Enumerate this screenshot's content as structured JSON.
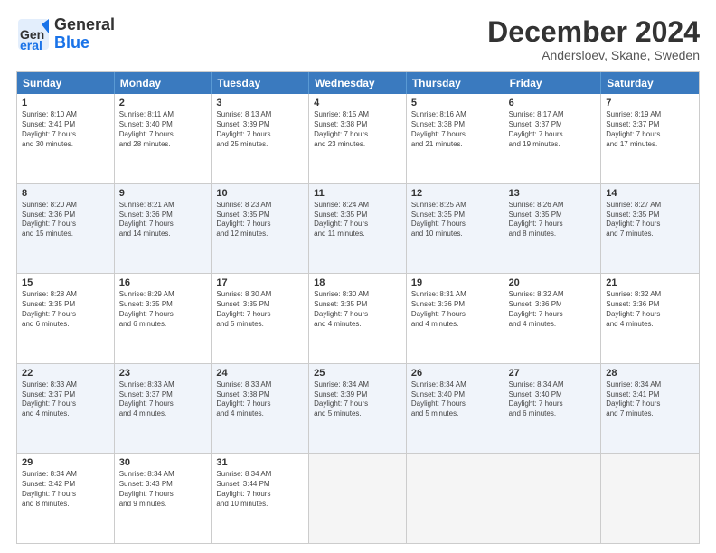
{
  "header": {
    "logo_general": "General",
    "logo_blue": "Blue",
    "month_title": "December 2024",
    "location": "Andersloev, Skane, Sweden"
  },
  "days_of_week": [
    "Sunday",
    "Monday",
    "Tuesday",
    "Wednesday",
    "Thursday",
    "Friday",
    "Saturday"
  ],
  "weeks": [
    [
      {
        "day": "1",
        "lines": [
          "Sunrise: 8:10 AM",
          "Sunset: 3:41 PM",
          "Daylight: 7 hours",
          "and 30 minutes."
        ]
      },
      {
        "day": "2",
        "lines": [
          "Sunrise: 8:11 AM",
          "Sunset: 3:40 PM",
          "Daylight: 7 hours",
          "and 28 minutes."
        ]
      },
      {
        "day": "3",
        "lines": [
          "Sunrise: 8:13 AM",
          "Sunset: 3:39 PM",
          "Daylight: 7 hours",
          "and 25 minutes."
        ]
      },
      {
        "day": "4",
        "lines": [
          "Sunrise: 8:15 AM",
          "Sunset: 3:38 PM",
          "Daylight: 7 hours",
          "and 23 minutes."
        ]
      },
      {
        "day": "5",
        "lines": [
          "Sunrise: 8:16 AM",
          "Sunset: 3:38 PM",
          "Daylight: 7 hours",
          "and 21 minutes."
        ]
      },
      {
        "day": "6",
        "lines": [
          "Sunrise: 8:17 AM",
          "Sunset: 3:37 PM",
          "Daylight: 7 hours",
          "and 19 minutes."
        ]
      },
      {
        "day": "7",
        "lines": [
          "Sunrise: 8:19 AM",
          "Sunset: 3:37 PM",
          "Daylight: 7 hours",
          "and 17 minutes."
        ]
      }
    ],
    [
      {
        "day": "8",
        "lines": [
          "Sunrise: 8:20 AM",
          "Sunset: 3:36 PM",
          "Daylight: 7 hours",
          "and 15 minutes."
        ]
      },
      {
        "day": "9",
        "lines": [
          "Sunrise: 8:21 AM",
          "Sunset: 3:36 PM",
          "Daylight: 7 hours",
          "and 14 minutes."
        ]
      },
      {
        "day": "10",
        "lines": [
          "Sunrise: 8:23 AM",
          "Sunset: 3:35 PM",
          "Daylight: 7 hours",
          "and 12 minutes."
        ]
      },
      {
        "day": "11",
        "lines": [
          "Sunrise: 8:24 AM",
          "Sunset: 3:35 PM",
          "Daylight: 7 hours",
          "and 11 minutes."
        ]
      },
      {
        "day": "12",
        "lines": [
          "Sunrise: 8:25 AM",
          "Sunset: 3:35 PM",
          "Daylight: 7 hours",
          "and 10 minutes."
        ]
      },
      {
        "day": "13",
        "lines": [
          "Sunrise: 8:26 AM",
          "Sunset: 3:35 PM",
          "Daylight: 7 hours",
          "and 8 minutes."
        ]
      },
      {
        "day": "14",
        "lines": [
          "Sunrise: 8:27 AM",
          "Sunset: 3:35 PM",
          "Daylight: 7 hours",
          "and 7 minutes."
        ]
      }
    ],
    [
      {
        "day": "15",
        "lines": [
          "Sunrise: 8:28 AM",
          "Sunset: 3:35 PM",
          "Daylight: 7 hours",
          "and 6 minutes."
        ]
      },
      {
        "day": "16",
        "lines": [
          "Sunrise: 8:29 AM",
          "Sunset: 3:35 PM",
          "Daylight: 7 hours",
          "and 6 minutes."
        ]
      },
      {
        "day": "17",
        "lines": [
          "Sunrise: 8:30 AM",
          "Sunset: 3:35 PM",
          "Daylight: 7 hours",
          "and 5 minutes."
        ]
      },
      {
        "day": "18",
        "lines": [
          "Sunrise: 8:30 AM",
          "Sunset: 3:35 PM",
          "Daylight: 7 hours",
          "and 4 minutes."
        ]
      },
      {
        "day": "19",
        "lines": [
          "Sunrise: 8:31 AM",
          "Sunset: 3:36 PM",
          "Daylight: 7 hours",
          "and 4 minutes."
        ]
      },
      {
        "day": "20",
        "lines": [
          "Sunrise: 8:32 AM",
          "Sunset: 3:36 PM",
          "Daylight: 7 hours",
          "and 4 minutes."
        ]
      },
      {
        "day": "21",
        "lines": [
          "Sunrise: 8:32 AM",
          "Sunset: 3:36 PM",
          "Daylight: 7 hours",
          "and 4 minutes."
        ]
      }
    ],
    [
      {
        "day": "22",
        "lines": [
          "Sunrise: 8:33 AM",
          "Sunset: 3:37 PM",
          "Daylight: 7 hours",
          "and 4 minutes."
        ]
      },
      {
        "day": "23",
        "lines": [
          "Sunrise: 8:33 AM",
          "Sunset: 3:37 PM",
          "Daylight: 7 hours",
          "and 4 minutes."
        ]
      },
      {
        "day": "24",
        "lines": [
          "Sunrise: 8:33 AM",
          "Sunset: 3:38 PM",
          "Daylight: 7 hours",
          "and 4 minutes."
        ]
      },
      {
        "day": "25",
        "lines": [
          "Sunrise: 8:34 AM",
          "Sunset: 3:39 PM",
          "Daylight: 7 hours",
          "and 5 minutes."
        ]
      },
      {
        "day": "26",
        "lines": [
          "Sunrise: 8:34 AM",
          "Sunset: 3:40 PM",
          "Daylight: 7 hours",
          "and 5 minutes."
        ]
      },
      {
        "day": "27",
        "lines": [
          "Sunrise: 8:34 AM",
          "Sunset: 3:40 PM",
          "Daylight: 7 hours",
          "and 6 minutes."
        ]
      },
      {
        "day": "28",
        "lines": [
          "Sunrise: 8:34 AM",
          "Sunset: 3:41 PM",
          "Daylight: 7 hours",
          "and 7 minutes."
        ]
      }
    ],
    [
      {
        "day": "29",
        "lines": [
          "Sunrise: 8:34 AM",
          "Sunset: 3:42 PM",
          "Daylight: 7 hours",
          "and 8 minutes."
        ]
      },
      {
        "day": "30",
        "lines": [
          "Sunrise: 8:34 AM",
          "Sunset: 3:43 PM",
          "Daylight: 7 hours",
          "and 9 minutes."
        ]
      },
      {
        "day": "31",
        "lines": [
          "Sunrise: 8:34 AM",
          "Sunset: 3:44 PM",
          "Daylight: 7 hours",
          "and 10 minutes."
        ]
      },
      {
        "day": "",
        "lines": []
      },
      {
        "day": "",
        "lines": []
      },
      {
        "day": "",
        "lines": []
      },
      {
        "day": "",
        "lines": []
      }
    ]
  ]
}
